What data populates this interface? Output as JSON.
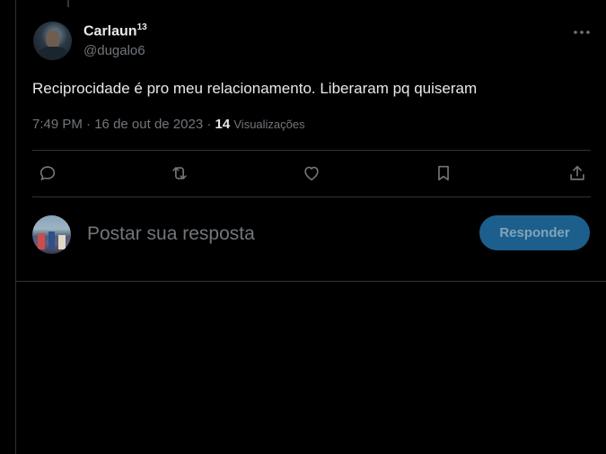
{
  "tweet": {
    "author_name": "Carlaun",
    "author_name_sup": "13",
    "handle": "@dugalo6",
    "text": "Reciprocidade é pro meu relacionamento. Liberaram pq quiseram",
    "time": "7:49 PM",
    "date": "16 de out de 2023",
    "views_count": "14",
    "views_label": "Visualizações"
  },
  "actions": [
    {
      "icon": "reply-icon"
    },
    {
      "icon": "retweet-icon"
    },
    {
      "icon": "like-icon"
    },
    {
      "icon": "bookmark-icon"
    },
    {
      "icon": "share-icon"
    }
  ],
  "reply_box": {
    "placeholder": "Postar sua resposta",
    "button_label": "Responder",
    "button_color": "#1d5f8c"
  },
  "colors": {
    "background": "#000000",
    "text": "#e7e9ea",
    "muted": "#71767b",
    "border": "#2f3336"
  }
}
